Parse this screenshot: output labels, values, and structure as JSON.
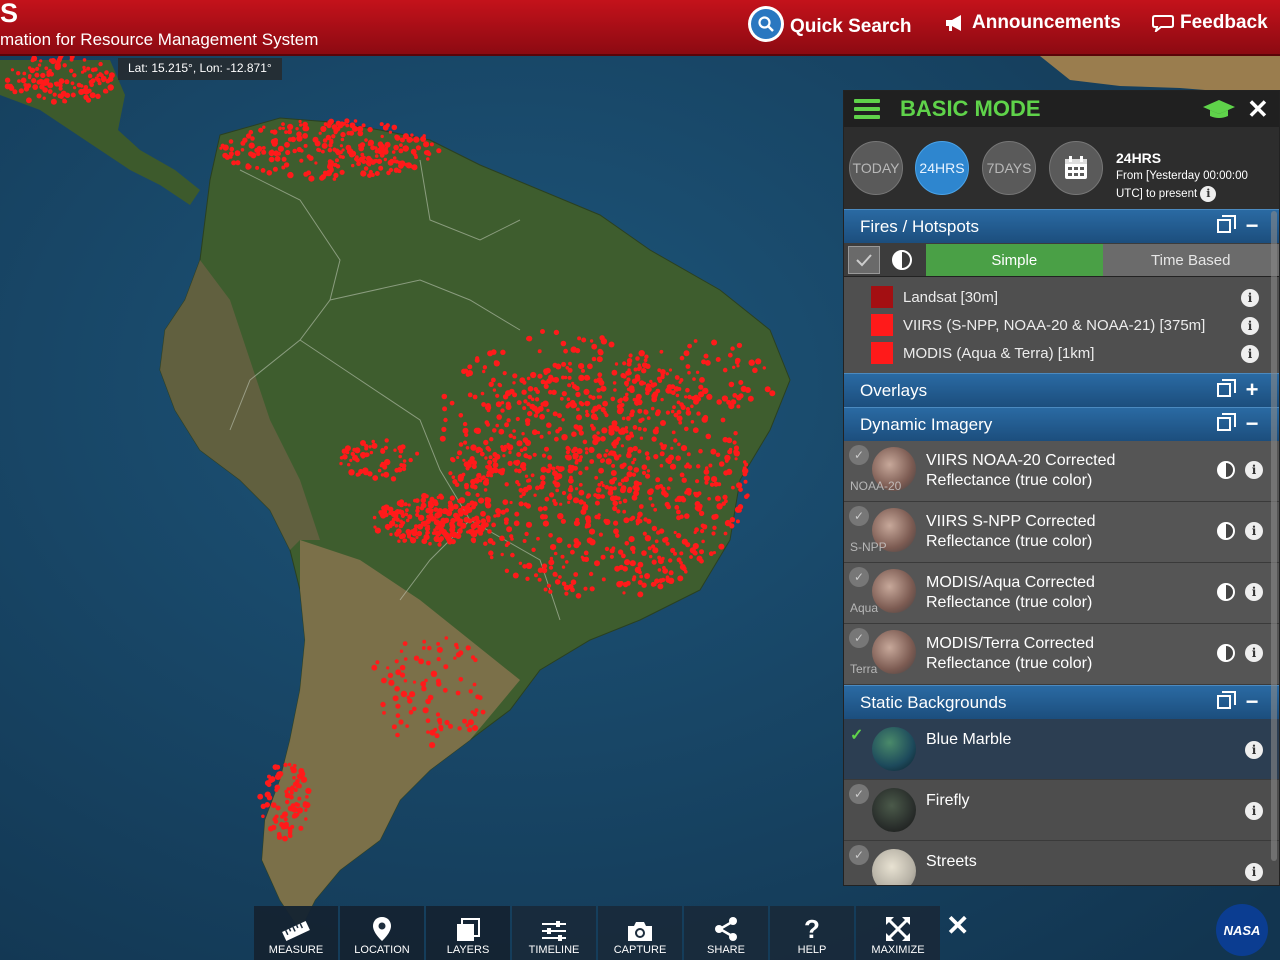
{
  "header": {
    "app_letter": "S",
    "subtitle": "mation for Resource Management System",
    "quick_search": "Quick Search",
    "announcements": "Announcements",
    "feedback": "Feedback"
  },
  "map": {
    "coords": "Lat: 15.215°, Lon: -12.871°",
    "colors": {
      "ocean": "#163f5c",
      "land": "#3a5a2c",
      "fire": "#ff1a1a"
    }
  },
  "panel": {
    "mode_title": "BASIC MODE",
    "time_buttons": [
      "TODAY",
      "24HRS",
      "7DAYS"
    ],
    "active_time": "24HRS",
    "time_heading": "24HRS",
    "time_line1": "From [Yesterday 00:00:00",
    "time_line2": "UTC] to present",
    "fires_section": "Fires / Hotspots",
    "tab_simple": "Simple",
    "tab_time_based": "Time Based",
    "fire_layers": [
      {
        "label": "Landsat [30m]",
        "color": "#a30f12"
      },
      {
        "label": "VIIRS (S-NPP, NOAA-20 & NOAA-21) [375m]",
        "color": "#ff1a1a"
      },
      {
        "label": "MODIS (Aqua & Terra) [1km]",
        "color": "#ff1a1a"
      }
    ],
    "overlays_section": "Overlays",
    "dynamic_section": "Dynamic Imagery",
    "dynamic_layers": [
      {
        "sat": "NOAA-20",
        "line1": "VIIRS NOAA-20 Corrected",
        "line2": "Reflectance (true color)"
      },
      {
        "sat": "S-NPP",
        "line1": "VIIRS S-NPP Corrected",
        "line2": "Reflectance (true color)"
      },
      {
        "sat": "Aqua",
        "line1": "MODIS/Aqua Corrected",
        "line2": "Reflectance (true color)"
      },
      {
        "sat": "Terra",
        "line1": "MODIS/Terra Corrected",
        "line2": "Reflectance (true color)"
      }
    ],
    "static_section": "Static Backgrounds",
    "backgrounds": [
      "Blue Marble",
      "Firefly",
      "Streets"
    ],
    "selected_background": "Blue Marble"
  },
  "toolbar": {
    "measure": "MEASURE",
    "location": "LOCATION",
    "layers": "LAYERS",
    "timeline": "TIMELINE",
    "capture": "CAPTURE",
    "share": "SHARE",
    "help": "HELP",
    "maximize": "MAXIMIZE"
  },
  "logo": "NASA"
}
